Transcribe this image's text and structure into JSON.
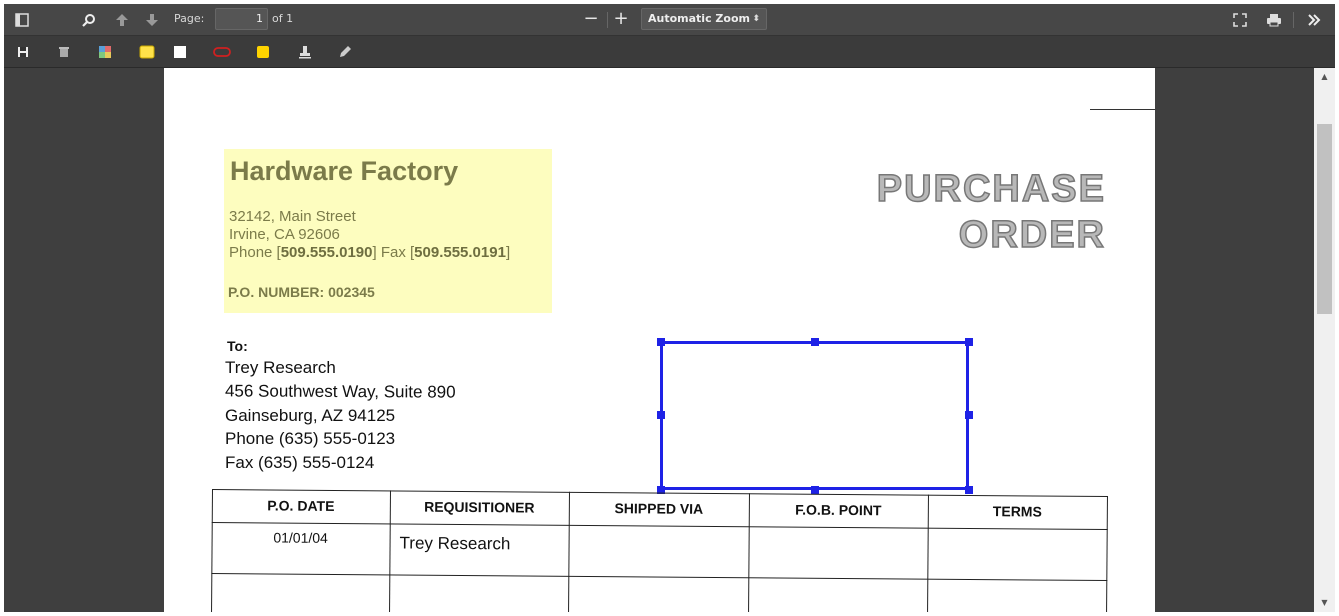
{
  "toolbar": {
    "sidebar_icon": "sidebar-toggle-icon",
    "search_icon": "search-icon",
    "prev_icon": "arrow-up-icon",
    "next_icon": "arrow-down-icon",
    "page_label": "Page:",
    "page_number": "1",
    "page_of": "of 1",
    "zoom_out": "−",
    "zoom_in": "+",
    "zoom_value": "Automatic Zoom",
    "zoom_arrow": "⬍",
    "presentation_icon": "fullscreen-icon",
    "print_icon": "printer-icon",
    "more_icon": "double-chevron-right-icon"
  },
  "annotation_toolbar": {
    "items": [
      "save-icon",
      "trash-icon",
      "color-grid-icon",
      "highlight-yellow-icon",
      "highlight-white-icon",
      "ellipse-red-icon",
      "sticky-note-icon",
      "stamp-icon",
      "pencil-icon"
    ]
  },
  "document": {
    "company": "Hardware Factory",
    "address_line1": "32142, Main Street",
    "address_line2": "Irvine, CA 92606",
    "phone_prefix": "Phone [",
    "phone": "509.555.0190",
    "fax_prefix": "]  Fax [",
    "fax": "509.555.0191",
    "fax_suffix": "]",
    "po_number": "P.O. NUMBER: 002345",
    "title_line1": "PURCHASE",
    "title_line2": "ORDER",
    "to_label": "To:",
    "to_lines": [
      "Trey Research",
      "456 Southwest Way, Suite 890",
      "Gainseburg, AZ 94125",
      "Phone (635) 555-0123",
      "Fax (635) 555-0124"
    ],
    "table": {
      "headers": [
        "P.O. DATE",
        "REQUISITIONER",
        "SHIPPED VIA",
        "F.O.B. POINT",
        "TERMS"
      ],
      "row1": [
        "01/01/04",
        "Trey Research",
        "",
        "",
        ""
      ]
    }
  },
  "colors": {
    "highlight": "#fdfdbf",
    "selection": "#1e22e6",
    "toolbar": "#474747"
  }
}
